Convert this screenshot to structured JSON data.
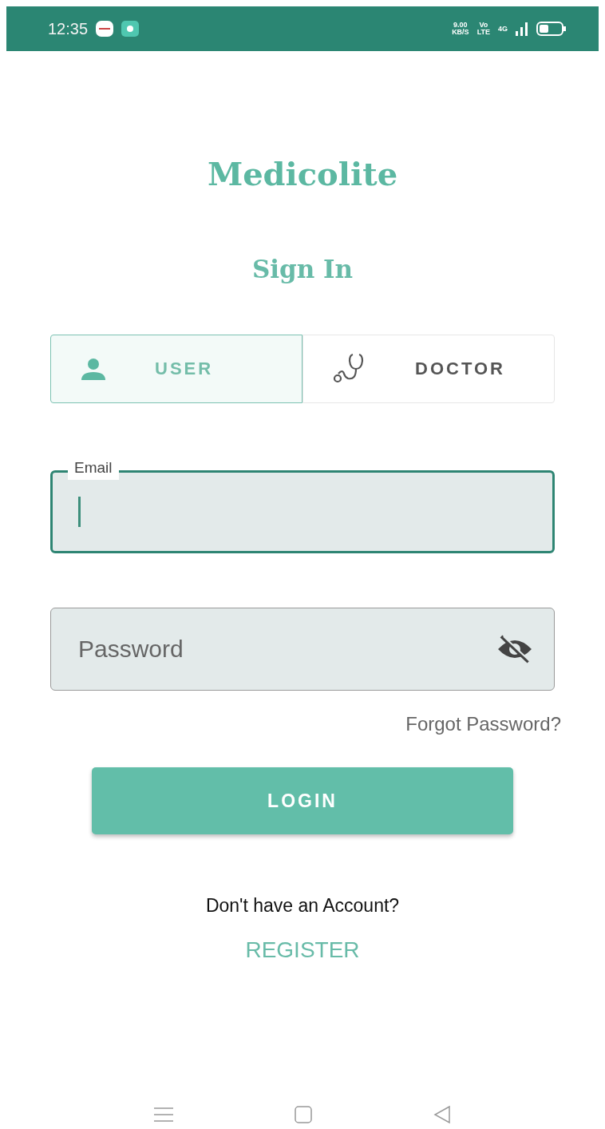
{
  "status_bar": {
    "time": "12:35",
    "speed_value": "9.00",
    "speed_unit": "KB/S",
    "volte_top": "Vo",
    "volte_bottom": "LTE",
    "network": "4G"
  },
  "app_title": "Medicolite",
  "heading": "Sign In",
  "role_tabs": [
    {
      "label": "USER",
      "kind": "user",
      "selected": true
    },
    {
      "label": "DOCTOR",
      "kind": "doctor",
      "selected": false
    }
  ],
  "email_field": {
    "label": "Email",
    "focused": true
  },
  "password_field": {
    "placeholder": "Password",
    "focused": false
  },
  "forgot_link": "Forgot Password?",
  "login_button": "LOGIN",
  "register_prompt": "Don't have an Account?",
  "register_link": "REGISTER"
}
